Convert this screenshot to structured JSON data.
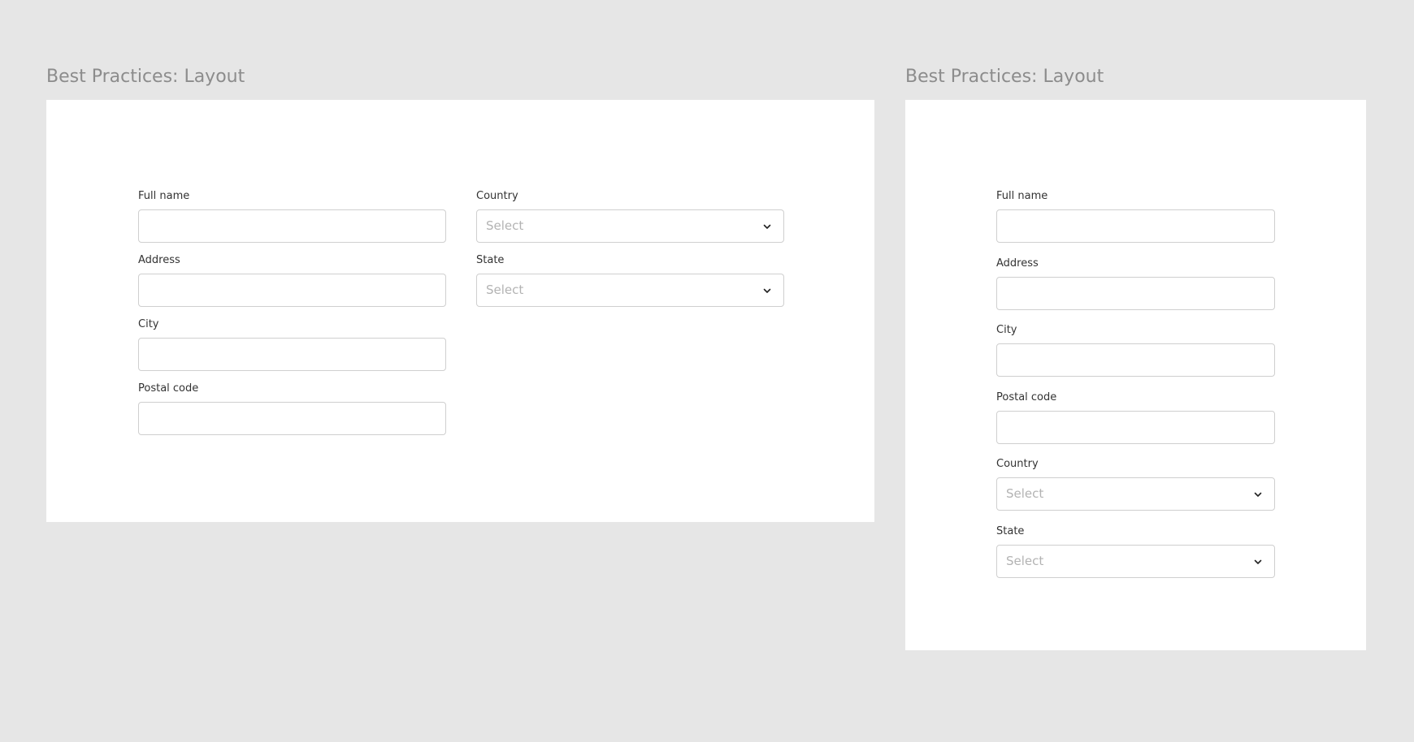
{
  "frames": [
    {
      "title": "Best Practices: Layout",
      "fields": {
        "full_name": {
          "label": "Full name",
          "value": ""
        },
        "address": {
          "label": "Address",
          "value": ""
        },
        "city": {
          "label": "City",
          "value": ""
        },
        "postal_code": {
          "label": "Postal code",
          "value": ""
        },
        "country": {
          "label": "Country",
          "placeholder": "Select",
          "icon": "chevron-down-icon"
        },
        "state": {
          "label": "State",
          "placeholder": "Select",
          "icon": "chevron-down-icon"
        }
      }
    },
    {
      "title": "Best Practices: Layout",
      "fields": {
        "full_name": {
          "label": "Full name",
          "value": ""
        },
        "address": {
          "label": "Address",
          "value": ""
        },
        "city": {
          "label": "City",
          "value": ""
        },
        "postal_code": {
          "label": "Postal code",
          "value": ""
        },
        "country": {
          "label": "Country",
          "placeholder": "Select",
          "icon": "chevron-down-icon"
        },
        "state": {
          "label": "State",
          "placeholder": "Select",
          "icon": "chevron-down-icon"
        }
      }
    }
  ],
  "colors": {
    "canvas": "#e6e6e6",
    "frame": "#ffffff",
    "title": "#8c8c8c",
    "label": "#333333",
    "border": "#cfcfcf",
    "placeholder": "#b3b3b3"
  }
}
